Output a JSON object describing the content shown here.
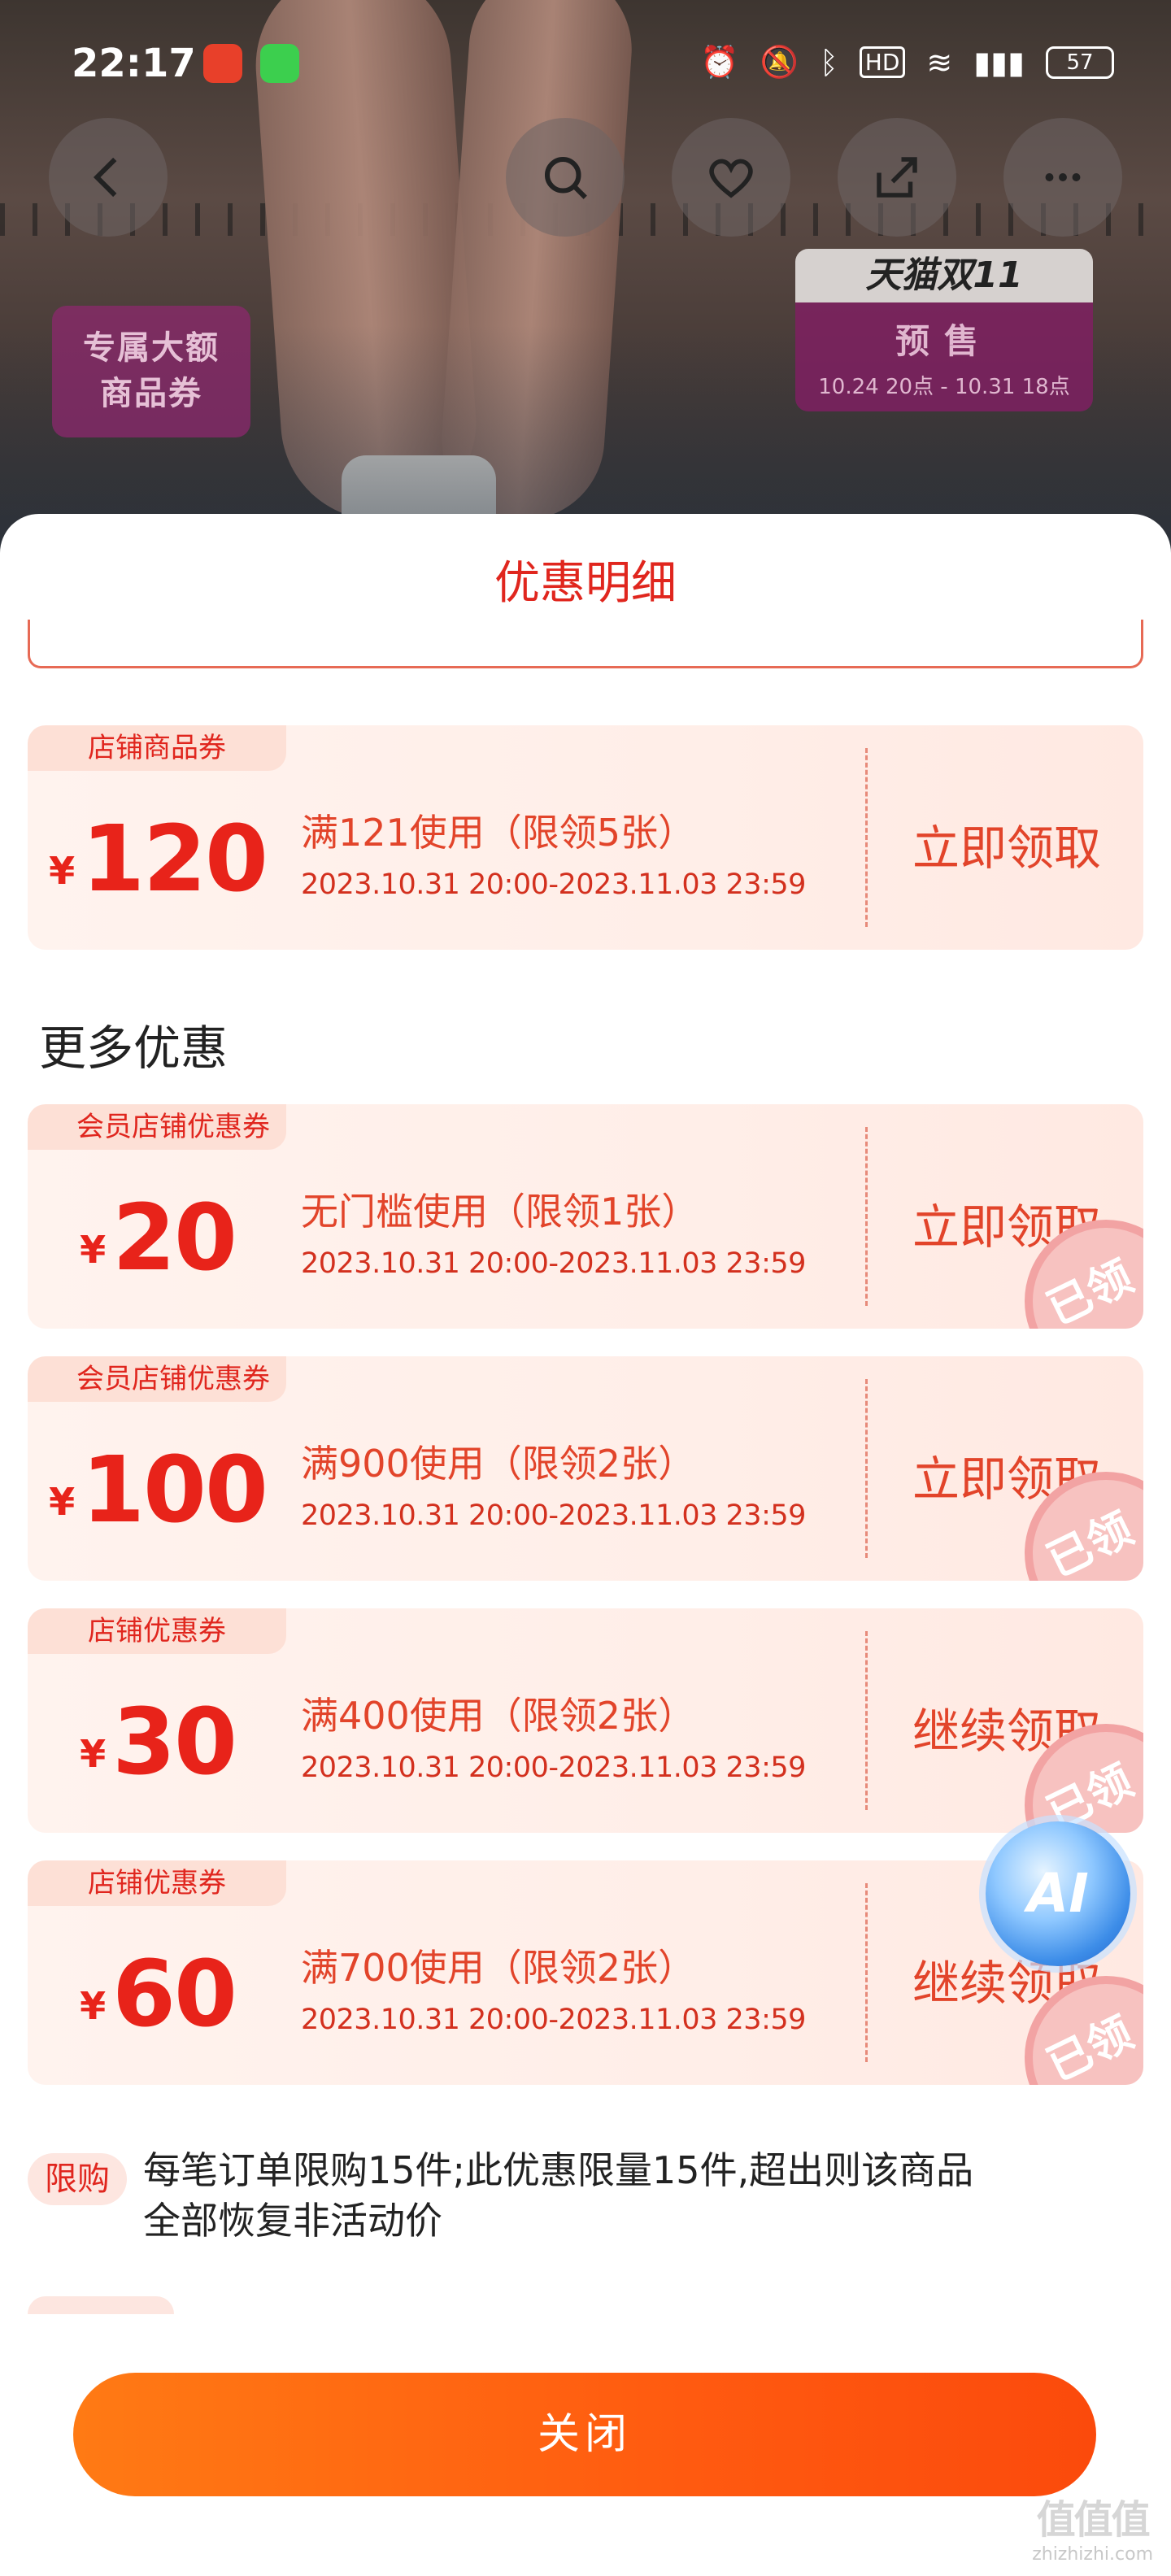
{
  "status_bar": {
    "time": "22:17",
    "battery": "57",
    "icons": [
      "alarm-icon",
      "mute-icon",
      "bluetooth-icon",
      "hd-icon",
      "wifi-icon",
      "signal-5g-icon",
      "battery-icon"
    ]
  },
  "hero": {
    "badge_line1": "专属大额",
    "badge_line2": "商品券",
    "tmall_title": "天猫双11",
    "tmall_presale": "预售",
    "tmall_dates": "10.24 20点 - 10.31 18点",
    "buttons": [
      "back-icon",
      "search-icon",
      "heart-icon",
      "share-icon",
      "more-icon"
    ]
  },
  "sheet": {
    "title": "优惠明细",
    "section_more": "更多优惠",
    "coupons": [
      {
        "tag": "店铺商品券",
        "yen": "¥",
        "amount": "120",
        "condition": "满121使用（限领5张）",
        "date": "2023.10.31 20:00-2023.11.03 23:59",
        "action": "立即领取",
        "claimed": ""
      },
      {
        "tag": "会员店铺优惠券",
        "yen": "¥",
        "amount": "20",
        "condition": "无门槛使用（限领1张）",
        "date": "2023.10.31 20:00-2023.11.03 23:59",
        "action": "立即领取",
        "claimed": "已领"
      },
      {
        "tag": "会员店铺优惠券",
        "yen": "¥",
        "amount": "100",
        "condition": "满900使用（限领2张）",
        "date": "2023.10.31 20:00-2023.11.03 23:59",
        "action": "立即领取",
        "claimed": "已领"
      },
      {
        "tag": "店铺优惠券",
        "yen": "¥",
        "amount": "30",
        "condition": "满400使用（限领2张）",
        "date": "2023.10.31 20:00-2023.11.03 23:59",
        "action": "继续领取",
        "claimed": "已领"
      },
      {
        "tag": "店铺优惠券",
        "yen": "¥",
        "amount": "60",
        "condition": "满700使用（限领2张）",
        "date": "2023.10.31 20:00-2023.11.03 23:59",
        "action": "继续领取",
        "claimed": "已领"
      }
    ],
    "limit_label": "限购",
    "limit_text": "每笔订单限购15件;此优惠限量15件,超出则该商品全部恢复非活动价",
    "ai_label": "AI",
    "close_label": "关闭"
  },
  "watermark": {
    "line1": "值值值",
    "line2": "zhizhizhi.com"
  },
  "colors": {
    "accent": "#e0261e",
    "button": "#ff5a10"
  }
}
